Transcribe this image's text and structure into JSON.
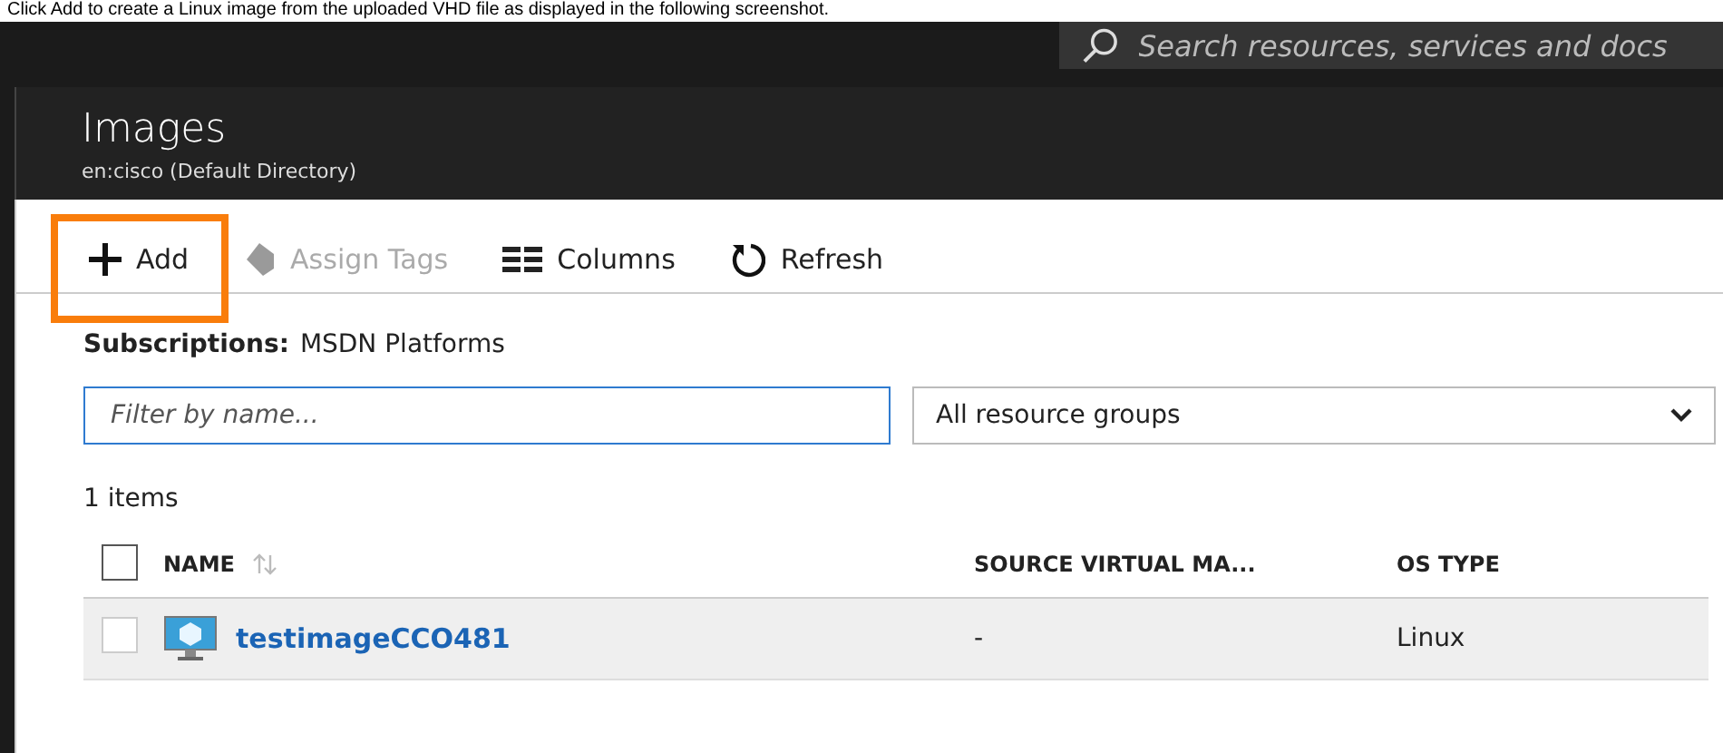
{
  "caption": "Click Add to create a Linux image from the uploaded VHD file as displayed in the following screenshot.",
  "search": {
    "placeholder": "Search resources, services and docs"
  },
  "blade": {
    "title": "Images",
    "subtitle": "en:cisco (Default Directory)"
  },
  "toolbar": [
    {
      "kind": "add",
      "label": "Add",
      "disabled": false,
      "highlighted": true
    },
    {
      "kind": "tag",
      "label": "Assign Tags",
      "disabled": true,
      "highlighted": false
    },
    {
      "kind": "columns",
      "label": "Columns",
      "disabled": false,
      "highlighted": false
    },
    {
      "kind": "refresh",
      "label": "Refresh",
      "disabled": false,
      "highlighted": false
    }
  ],
  "subscriptions": {
    "label": "Subscriptions:",
    "value": "MSDN Platforms"
  },
  "filter": {
    "placeholder": "Filter by name..."
  },
  "group_select": {
    "value": "All resource groups"
  },
  "count": "1 items",
  "table": {
    "select_all": {
      "checked": false
    },
    "columns": [
      {
        "label": "NAME",
        "sortable": true
      },
      {
        "label": "SOURCE VIRTUAL MA...",
        "sortable": false
      },
      {
        "label": "OS TYPE",
        "sortable": false
      }
    ],
    "rows": [
      {
        "checked": false,
        "name": "testimageCCO481",
        "source": "-",
        "os": "Linux"
      }
    ]
  }
}
